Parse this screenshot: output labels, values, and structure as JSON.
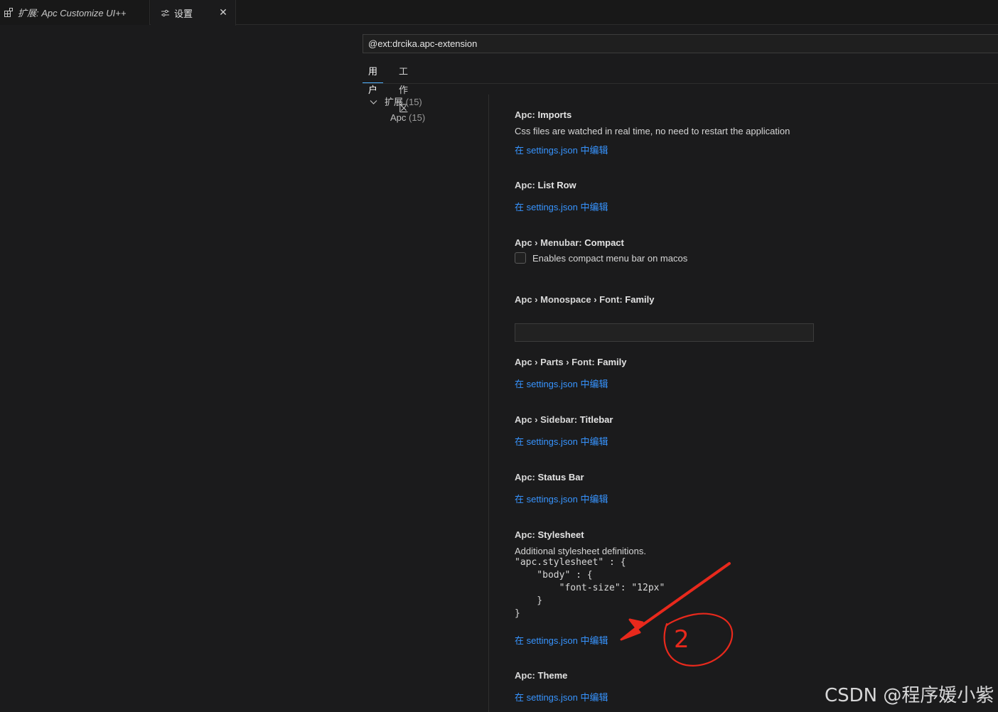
{
  "tabs": [
    {
      "label": "扩展: Apc Customize UI++"
    },
    {
      "label": "设置"
    }
  ],
  "search": {
    "value": "@ext:drcika.apc-extension"
  },
  "scopes": [
    {
      "label": "用户"
    },
    {
      "label": "工作区"
    }
  ],
  "toc": [
    {
      "label": "扩展",
      "count": "(15)"
    },
    {
      "label": "Apc",
      "count": "(15)"
    }
  ],
  "edit_link": "在 settings.json 中编辑",
  "settings": [
    {
      "category": "Apc: ",
      "name": "Imports",
      "desc": "Css files are watched in real time, no need to restart the application"
    },
    {
      "category": "Apc: ",
      "name": "List Row"
    },
    {
      "category": "Apc › Menubar: ",
      "name": "Compact",
      "checkbox_label": "Enables compact menu bar on macos"
    },
    {
      "category": "Apc › Monospace › Font: ",
      "name": "Family",
      "value": ""
    },
    {
      "category": "Apc › Parts › Font: ",
      "name": "Family"
    },
    {
      "category": "Apc › Sidebar: ",
      "name": "Titlebar"
    },
    {
      "category": "Apc: ",
      "name": "Status Bar"
    },
    {
      "category": "Apc: ",
      "name": "Stylesheet",
      "desc": "Additional stylesheet definitions.",
      "code": "\"apc.stylesheet\" : {\n    \"body\" : {\n        \"font-size\": \"12px\"\n    }\n}"
    },
    {
      "category": "Apc: ",
      "name": "Theme"
    }
  ],
  "annotation": {
    "label": "2",
    "color": "#e8291c"
  },
  "watermark": "CSDN @程序媛小紫"
}
